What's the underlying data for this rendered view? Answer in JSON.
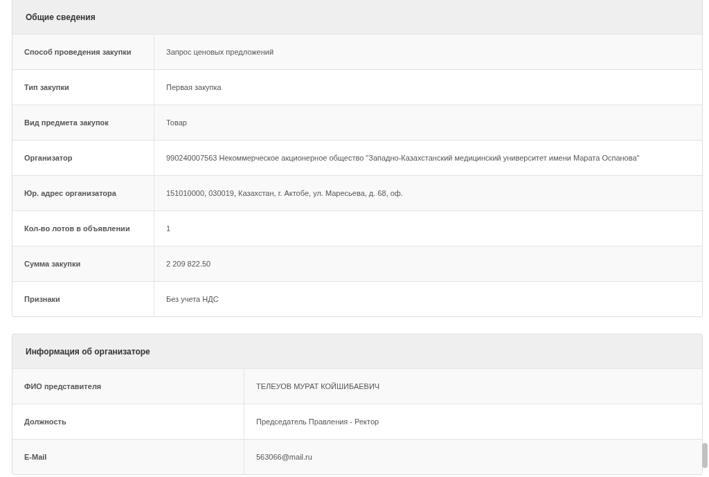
{
  "panels": [
    {
      "title": "Общие сведения",
      "rows": [
        {
          "label": "Способ проведения закупки",
          "value": "Запрос ценовых предложений"
        },
        {
          "label": "Тип закупки",
          "value": "Первая закупка"
        },
        {
          "label": "Вид предмета закупок",
          "value": "Товар"
        },
        {
          "label": "Организатор",
          "value": "990240007563 Некоммерческое акционерное общество \"Западно-Казахстанский медицинский университет имени Марата Оспанова\""
        },
        {
          "label": "Юр. адрес организатора",
          "value": "151010000, 030019, Казахстан, г. Актобе, ул. Маресьева, д. 68, оф."
        },
        {
          "label": "Кол-во лотов в объявлении",
          "value": "1"
        },
        {
          "label": "Сумма закупки",
          "value": "2 209 822.50"
        },
        {
          "label": "Признаки",
          "value": "Без учета НДС"
        }
      ]
    },
    {
      "title": "Информация об организаторе",
      "rows": [
        {
          "label": "ФИО представителя",
          "value": "ТЕЛЕУОВ МУРАТ КОЙШИБАЕВИЧ"
        },
        {
          "label": "Должность",
          "value": "Председатель Правления - Ректор"
        },
        {
          "label": "E-Mail",
          "value": "563066@mail.ru"
        }
      ]
    }
  ]
}
